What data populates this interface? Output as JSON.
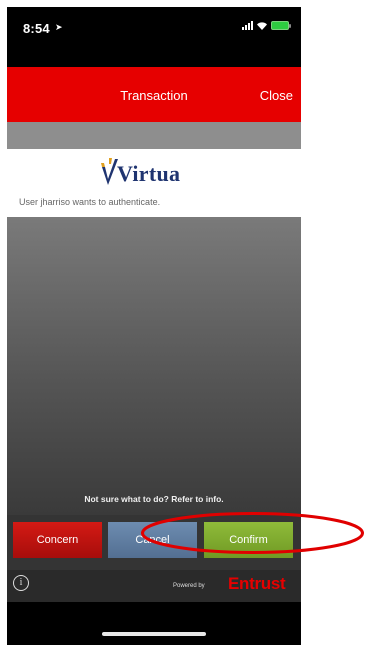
{
  "status_bar": {
    "time": "8:54"
  },
  "header": {
    "title": "Transaction",
    "close_label": "Close"
  },
  "card": {
    "logo_text": "Virtua",
    "message": "User jharriso wants to authenticate."
  },
  "help_text": "Not sure what to do? Refer to info.",
  "buttons": {
    "concern": "Concern",
    "cancel": "Cancel",
    "confirm": "Confirm"
  },
  "footer": {
    "info_icon": "i",
    "powered_by": "Powered by",
    "brand": "Entrust"
  },
  "colors": {
    "header_red": "#e60000",
    "concern_red": "#c4140f",
    "cancel_blue": "#6380a4",
    "confirm_green": "#80ab30",
    "annotation_red": "#e00000"
  },
  "icons": [
    "location-arrow-icon",
    "signal-icon",
    "wifi-icon",
    "battery-icon",
    "info-icon"
  ]
}
